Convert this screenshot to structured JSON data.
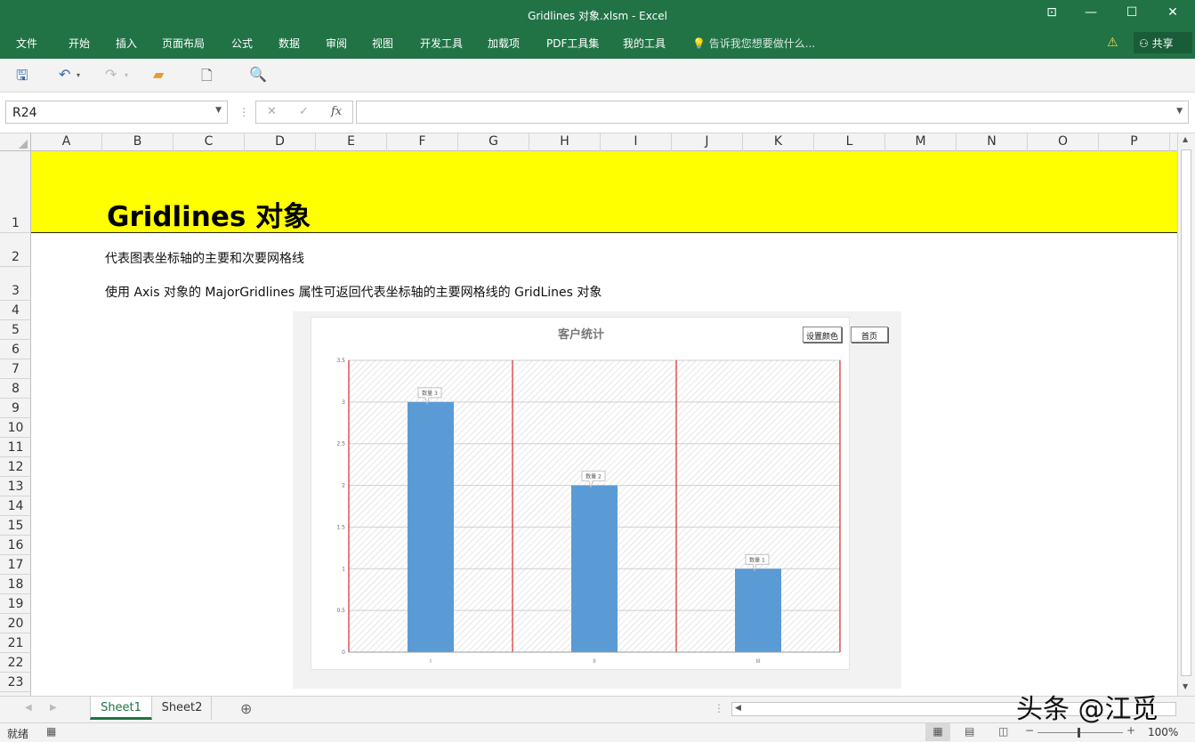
{
  "window": {
    "title": "Gridlines 对象.xlsm - Excel"
  },
  "ribbon": {
    "tabs": [
      "文件",
      "开始",
      "插入",
      "页面布局",
      "公式",
      "数据",
      "审阅",
      "视图",
      "开发工具",
      "加载项",
      "PDF工具集",
      "我的工具"
    ],
    "tell_me": "告诉我您想要做什么...",
    "share": "共享"
  },
  "formula_bar": {
    "name_box": "R24",
    "fx_label": "fx",
    "formula": ""
  },
  "columns": [
    "A",
    "B",
    "C",
    "D",
    "E",
    "F",
    "G",
    "H",
    "I",
    "J",
    "K",
    "L",
    "M",
    "N",
    "O",
    "P"
  ],
  "rows": [
    "1",
    "2",
    "3",
    "4",
    "5",
    "6",
    "7",
    "8",
    "9",
    "10",
    "11",
    "12",
    "13",
    "14",
    "15",
    "16",
    "17",
    "18",
    "19",
    "20",
    "21",
    "22",
    "23"
  ],
  "sheet": {
    "heading": "Gridlines 对象",
    "line1": "代表图表坐标轴的主要和次要网格线",
    "line2": "使用 Axis 对象的 MajorGridlines 属性可返回代表坐标轴的主要网格线的 GridLines 对象",
    "header_color": "#ffff00"
  },
  "chart_buttons": {
    "set_color": "设置颜色",
    "home": "首页"
  },
  "chart_data": {
    "type": "bar",
    "title": "客户统计",
    "categories": [
      "I",
      "II",
      "III"
    ],
    "values": [
      3,
      2,
      1
    ],
    "data_labels": [
      "数量 3",
      "数量 2",
      "数量 1"
    ],
    "ylim": [
      0,
      3.5
    ],
    "yticks": [
      "0",
      "0.5",
      "1",
      "1.5",
      "2",
      "2.5",
      "3",
      "3.5"
    ],
    "bar_color": "#5b9bd5",
    "vertical_gridline_color": "#cc0000",
    "grid": true
  },
  "sheets": {
    "tabs": [
      "Sheet1",
      "Sheet2"
    ],
    "active": "Sheet1"
  },
  "status": {
    "ready": "就绪",
    "zoom": "100%"
  },
  "watermark": "头条 @江觅"
}
